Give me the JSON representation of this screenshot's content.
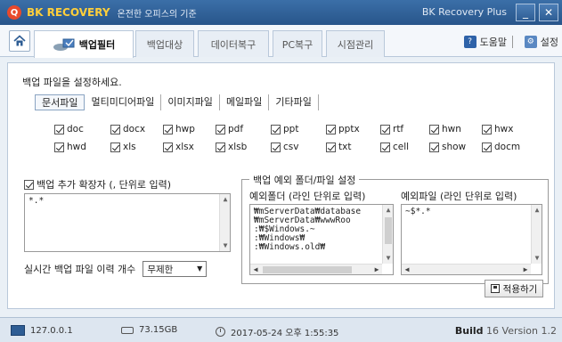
{
  "titlebar": {
    "logo_letter": "Q",
    "brand": "BK RECOVERY",
    "tagline": "온전한 오피스의 기준",
    "app_name": "BK Recovery Plus",
    "min_label": "_",
    "close_label": "✕"
  },
  "toolbar": {
    "tabs": [
      {
        "label": "백업필터"
      },
      {
        "label": "백업대상"
      },
      {
        "label": "데이터복구"
      },
      {
        "label": "PC복구"
      },
      {
        "label": "시점관리"
      }
    ],
    "help_label": "도움말",
    "settings_label": "설정",
    "help_icon": "?",
    "settings_icon": "⚙"
  },
  "panel": {
    "instruction": "백업 파일을 설정하세요.",
    "file_tabs": [
      "문서파일",
      "멀티미디어파일",
      "이미지파일",
      "메일파일",
      "기타파일"
    ],
    "extensions_row1": [
      "doc",
      "docx",
      "hwp",
      "pdf",
      "ppt",
      "pptx",
      "rtf",
      "hwn",
      "hwx"
    ],
    "extensions_row2": [
      "hwd",
      "xls",
      "xlsx",
      "xlsb",
      "csv",
      "txt",
      "cell",
      "show",
      "docm"
    ],
    "add_ext_label": "백업 추가 확장자 (, 단위로 입력)",
    "add_ext_value": "*.*",
    "history_label": "실시간 백업 파일 이력 개수",
    "history_value": "무제한",
    "exclusion_legend": "백업 예외 폴더/파일 설정",
    "exclude_folder_label": "예외폴더 (라인 단위로 입력)",
    "exclude_folder_lines": [
      "₩mServerData₩database",
      "₩mServerData₩wwwRoo",
      ":₩$Windows.~",
      ":₩Windows₩",
      ":₩Windows.old₩"
    ],
    "exclude_file_label": "예외파일 (라인 단위로 입력)",
    "exclude_file_value": "~$*.*",
    "apply_label": "적용하기"
  },
  "status": {
    "ip": "127.0.0.1",
    "disk": "73.15GB",
    "datetime": "2017-05-24 오후 1:55:35",
    "build_label": "Build",
    "build_number": "16",
    "version": "Version 1.2"
  }
}
